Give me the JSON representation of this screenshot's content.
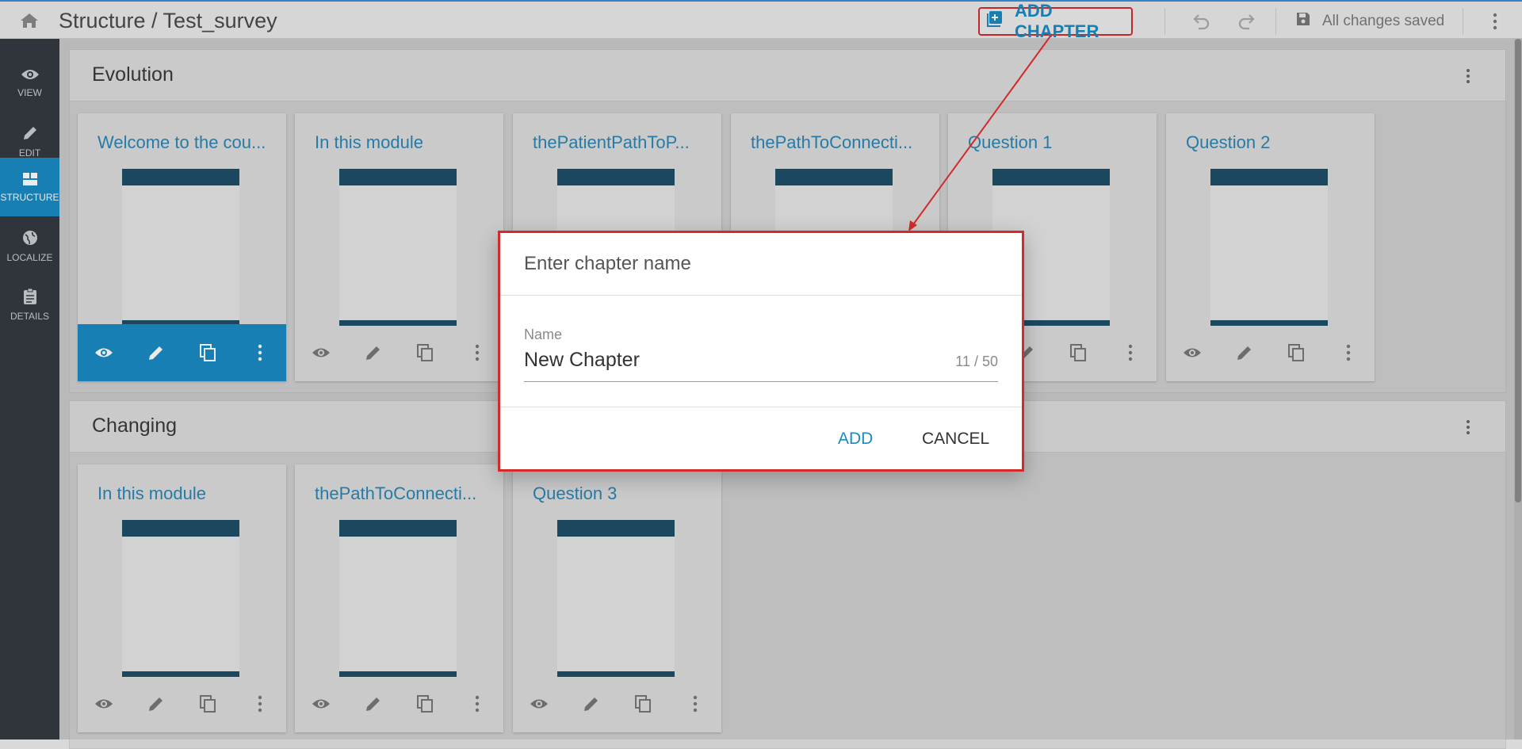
{
  "header": {
    "title": "Structure / Test_survey",
    "add_chapter_label": "ADD CHAPTER",
    "save_status": "All changes saved"
  },
  "sidebar": {
    "items": [
      {
        "label": "VIEW",
        "icon": "eye-icon",
        "active": false
      },
      {
        "label": "EDIT",
        "icon": "pencil-icon",
        "active": false
      },
      {
        "label": "STRUCTURE",
        "icon": "structure-icon",
        "active": true
      },
      {
        "label": "LOCALIZE",
        "icon": "globe-icon",
        "active": false
      },
      {
        "label": "DETAILS",
        "icon": "clipboard-icon",
        "active": false
      }
    ]
  },
  "chapters": [
    {
      "title": "Evolution",
      "cards": [
        {
          "title": "Welcome to the cou...",
          "selected": true
        },
        {
          "title": "In this module",
          "selected": false
        },
        {
          "title": "thePatientPathToP...",
          "selected": false
        },
        {
          "title": "thePathToConnecti...",
          "selected": false
        },
        {
          "title": "Question 1",
          "selected": false
        },
        {
          "title": "Question 2",
          "selected": false
        }
      ]
    },
    {
      "title": "Changing",
      "cards": [
        {
          "title": "In this module",
          "selected": false
        },
        {
          "title": "thePathToConnecti...",
          "selected": false
        },
        {
          "title": "Question 3",
          "selected": false
        }
      ]
    }
  ],
  "dialog": {
    "title": "Enter chapter name",
    "field_label": "Name",
    "field_value": "New Chapter",
    "char_count": "11 / 50",
    "add_label": "ADD",
    "cancel_label": "CANCEL"
  },
  "colors": {
    "accent": "#1b8ac4",
    "highlight": "#d32b2b",
    "sidebar_bg": "#333a40"
  }
}
